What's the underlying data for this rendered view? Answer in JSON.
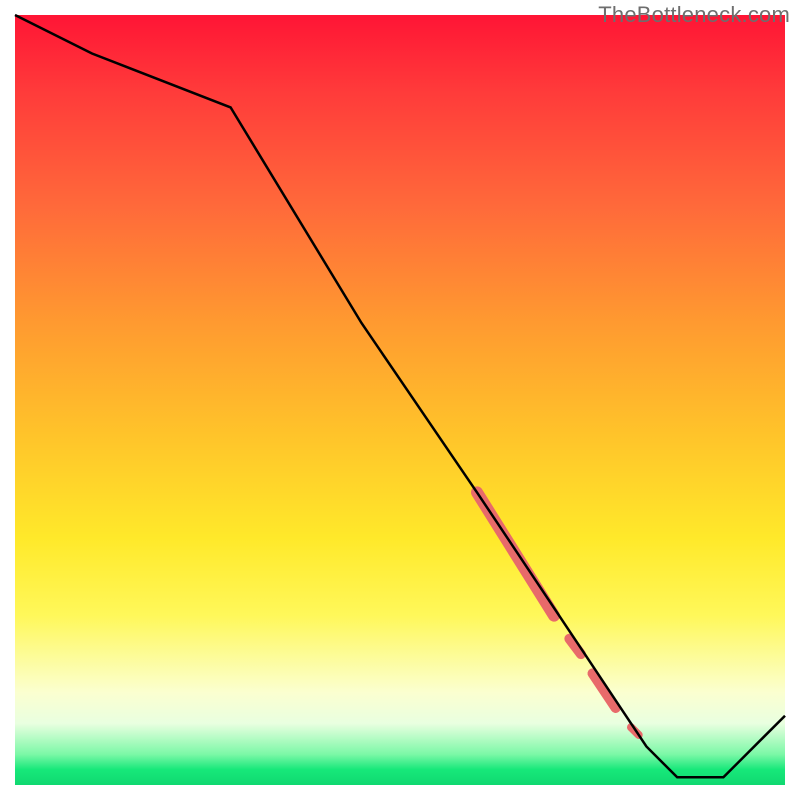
{
  "watermark": "TheBottleneck.com",
  "chart_data": {
    "type": "line",
    "title": "",
    "xlabel": "",
    "ylabel": "",
    "xlim": [
      0,
      100
    ],
    "ylim": [
      0,
      100
    ],
    "grid": false,
    "series": [
      {
        "name": "curve",
        "x": [
          0,
          10,
          28,
          45,
          60,
          68,
          74,
          78,
          82,
          86,
          92,
          100
        ],
        "y": [
          100,
          95,
          88,
          60,
          38,
          26,
          17,
          11,
          5,
          1,
          1,
          9
        ]
      }
    ],
    "highlight_segments": [
      {
        "x0": 60,
        "y0": 38,
        "x1": 70,
        "y1": 22,
        "thick": 12
      },
      {
        "x0": 72,
        "y0": 19,
        "x1": 73.5,
        "y1": 17,
        "thick": 10
      },
      {
        "x0": 75,
        "y0": 14.5,
        "x1": 78,
        "y1": 10,
        "thick": 10
      },
      {
        "x0": 80,
        "y0": 7.5,
        "x1": 81,
        "y1": 6.5,
        "thick": 8
      }
    ],
    "colors": {
      "line": "#000000",
      "highlight": "#e86a6a"
    }
  }
}
